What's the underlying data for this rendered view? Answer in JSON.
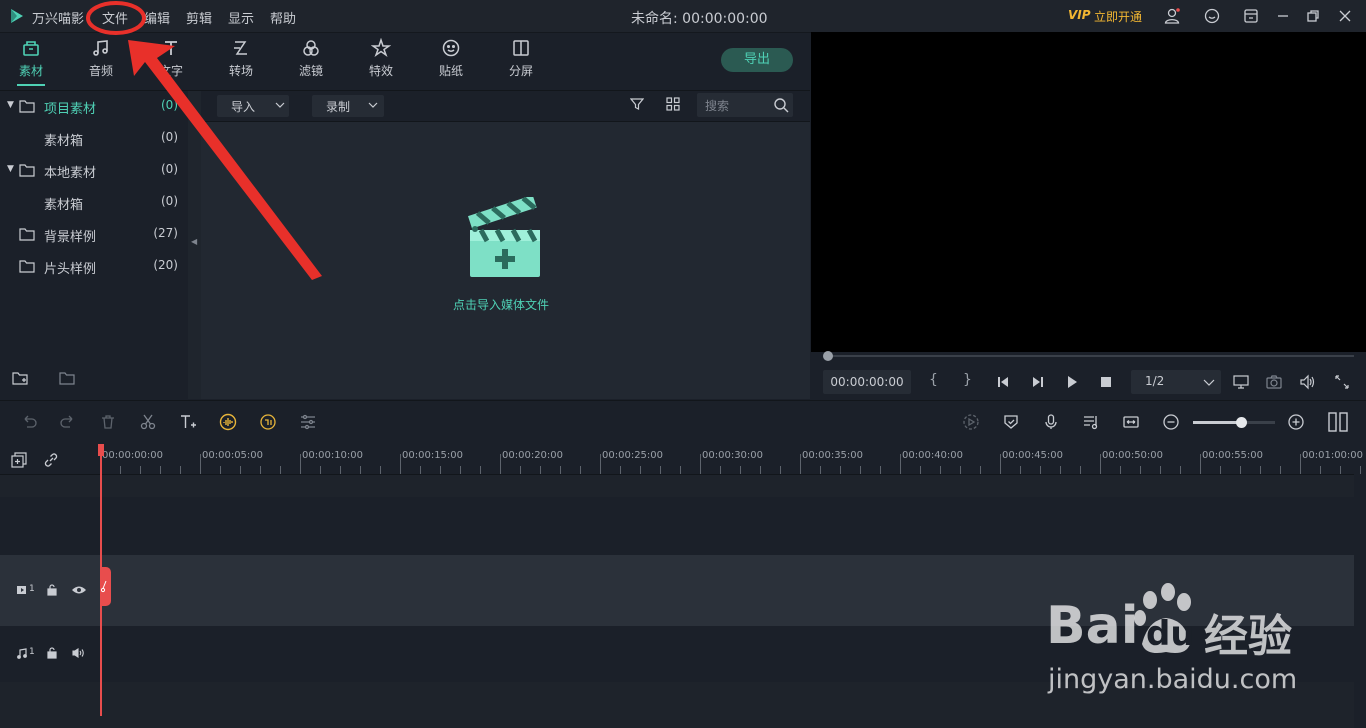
{
  "app": {
    "name": "万兴喵影",
    "project_title": "未命名: 00:00:00:00",
    "vip_text": "VIP",
    "vip_link": "立即开通"
  },
  "menu": [
    "文件",
    "编辑",
    "剪辑",
    "显示",
    "帮助"
  ],
  "media_tabs": [
    {
      "label": "素材",
      "icon": "media-box-icon",
      "active": true
    },
    {
      "label": "音频",
      "icon": "music-note-icon"
    },
    {
      "label": "文字",
      "icon": "text-icon"
    },
    {
      "label": "转场",
      "icon": "transition-icon"
    },
    {
      "label": "滤镜",
      "icon": "filter-icon"
    },
    {
      "label": "特效",
      "icon": "effects-icon"
    },
    {
      "label": "贴纸",
      "icon": "sticker-icon"
    },
    {
      "label": "分屏",
      "icon": "split-screen-icon"
    }
  ],
  "export_button": "导出",
  "tree": [
    {
      "label": "项目素材",
      "count": "(0)",
      "expanded": true,
      "selected": true,
      "indent": 0
    },
    {
      "label": "素材箱",
      "count": "(0)",
      "indent": 1
    },
    {
      "label": "本地素材",
      "count": "(0)",
      "expanded": true,
      "indent": 0
    },
    {
      "label": "素材箱",
      "count": "(0)",
      "indent": 1
    },
    {
      "label": "背景样例",
      "count": "(27)",
      "indent": 0
    },
    {
      "label": "片头样例",
      "count": "(20)",
      "indent": 0
    }
  ],
  "media_toolbar": {
    "import_label": "导入",
    "record_label": "录制",
    "search_placeholder": "搜索"
  },
  "media_empty": {
    "import_hint": "点击导入媒体文件"
  },
  "preview": {
    "timecode": "00:00:00:00",
    "bracket_in": "{",
    "bracket_out": "}",
    "quality": "1/2"
  },
  "timeline": {
    "ticks": [
      "00:00:00:00",
      "00:00:05:00",
      "00:00:10:00",
      "00:00:15:00",
      "00:00:20:00",
      "00:00:25:00",
      "00:00:30:00",
      "00:00:35:00",
      "00:00:40:00",
      "00:00:45:00",
      "00:00:50:00",
      "00:00:55:00",
      "00:01:00:00"
    ],
    "video_track_label": "1",
    "audio_track_label": "1"
  },
  "watermark": {
    "brand": "Bai",
    "brand2": "du",
    "jingyan": "经验",
    "url": "jingyan.baidu.com"
  },
  "colors": {
    "accent": "#4fd1b5",
    "playhead": "#e84d4d",
    "annotation_red": "#e8302a",
    "vip_gold": "#f2b632"
  }
}
